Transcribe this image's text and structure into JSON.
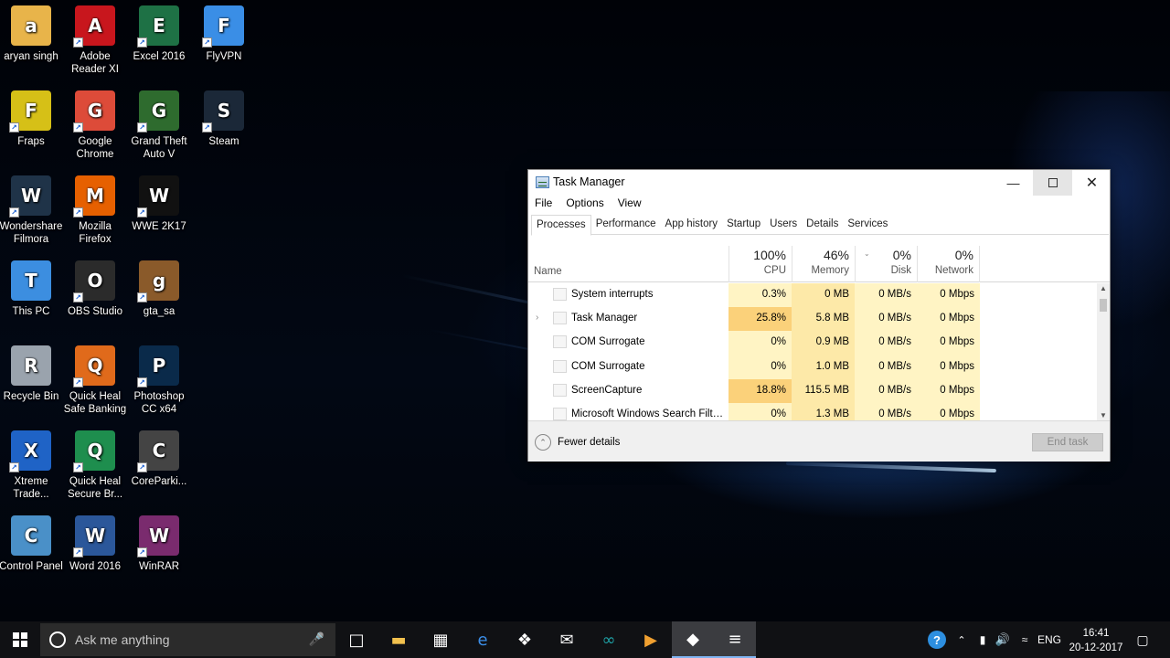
{
  "desktop": {
    "icons": [
      {
        "label": "aryan singh",
        "icon": "user-folder-icon",
        "color": "#e8b44a"
      },
      {
        "label": "Adobe Reader XI",
        "icon": "adobe-reader-icon",
        "color": "#c8161d"
      },
      {
        "label": "Excel 2016",
        "icon": "excel-icon",
        "color": "#1e7145"
      },
      {
        "label": "FlyVPN",
        "icon": "flyvpn-icon",
        "color": "#3a8ee6"
      },
      {
        "label": "Fraps",
        "icon": "fraps-icon",
        "color": "#d6c017"
      },
      {
        "label": "Google Chrome",
        "icon": "chrome-icon",
        "color": "#dd4b39"
      },
      {
        "label": "Grand Theft Auto V",
        "icon": "gta-v-icon",
        "color": "#2e6b2e"
      },
      {
        "label": "Steam",
        "icon": "steam-icon",
        "color": "#1b2838"
      },
      {
        "label": "Wondershare Filmora",
        "icon": "filmora-icon",
        "color": "#1f3348"
      },
      {
        "label": "Mozilla Firefox",
        "icon": "firefox-icon",
        "color": "#e66000"
      },
      {
        "label": "WWE 2K17",
        "icon": "wwe-icon",
        "color": "#111111"
      },
      {
        "label": "This PC",
        "icon": "this-pc-icon",
        "color": "#3c8ee0"
      },
      {
        "label": "OBS Studio",
        "icon": "obs-icon",
        "color": "#2b2b2b"
      },
      {
        "label": "gta_sa",
        "icon": "gta-sa-icon",
        "color": "#8a5a2a"
      },
      {
        "label": "Recycle Bin",
        "icon": "recycle-bin-icon",
        "color": "#9aa3ad"
      },
      {
        "label": "Quick Heal Safe Banking",
        "icon": "quick-heal-safe-banking-icon",
        "color": "#e06a1b"
      },
      {
        "label": "Photoshop CC x64",
        "icon": "photoshop-icon",
        "color": "#0a2a4a"
      },
      {
        "label": "Xtreme Trade...",
        "icon": "xtreme-trade-icon",
        "color": "#1f63c6"
      },
      {
        "label": "Quick Heal Secure Br...",
        "icon": "quick-heal-secure-browser-icon",
        "color": "#1e8e4e"
      },
      {
        "label": "CoreParki...",
        "icon": "coreparking-icon",
        "color": "#444444"
      },
      {
        "label": "Control Panel",
        "icon": "control-panel-icon",
        "color": "#4a90c8"
      },
      {
        "label": "Word 2016",
        "icon": "word-icon",
        "color": "#2b579a"
      },
      {
        "label": "WinRAR",
        "icon": "winrar-icon",
        "color": "#7a2b6e"
      }
    ]
  },
  "task_manager": {
    "title": "Task Manager",
    "menu": [
      "File",
      "Options",
      "View"
    ],
    "tabs": [
      "Processes",
      "Performance",
      "App history",
      "Startup",
      "Users",
      "Details",
      "Services"
    ],
    "active_tab": "Processes",
    "columns": {
      "name": "Name",
      "cpu": {
        "pct": "100%",
        "label": "CPU"
      },
      "memory": {
        "pct": "46%",
        "label": "Memory"
      },
      "disk": {
        "pct": "0%",
        "label": "Disk"
      },
      "network": {
        "pct": "0%",
        "label": "Network"
      }
    },
    "rows": [
      {
        "name": "System interrupts",
        "cpu": "0.3%",
        "memory": "0 MB",
        "disk": "0 MB/s",
        "network": "0 Mbps",
        "expandable": false
      },
      {
        "name": "Task Manager",
        "cpu": "25.8%",
        "memory": "5.8 MB",
        "disk": "0 MB/s",
        "network": "0 Mbps",
        "expandable": true
      },
      {
        "name": "COM Surrogate",
        "cpu": "0%",
        "memory": "0.9 MB",
        "disk": "0 MB/s",
        "network": "0 Mbps",
        "expandable": false
      },
      {
        "name": "COM Surrogate",
        "cpu": "0%",
        "memory": "1.0 MB",
        "disk": "0 MB/s",
        "network": "0 Mbps",
        "expandable": false
      },
      {
        "name": "ScreenCapture",
        "cpu": "18.8%",
        "memory": "115.5 MB",
        "disk": "0 MB/s",
        "network": "0 Mbps",
        "expandable": false
      },
      {
        "name": "Microsoft Windows Search Filte...",
        "cpu": "0%",
        "memory": "1.3 MB",
        "disk": "0 MB/s",
        "network": "0 Mbps",
        "expandable": false
      }
    ],
    "heat_colors": {
      "low": "#fff4c4",
      "mid": "#fde9a8",
      "high": "#fbd17a"
    },
    "fewer_details": "Fewer details",
    "end_task": "End task"
  },
  "taskbar": {
    "search_placeholder": "Ask me anything",
    "apps": [
      {
        "icon": "task-view-icon"
      },
      {
        "icon": "file-explorer-icon"
      },
      {
        "icon": "store-icon"
      },
      {
        "icon": "edge-icon"
      },
      {
        "icon": "dropbox-icon"
      },
      {
        "icon": "mail-icon"
      },
      {
        "icon": "arduino-icon"
      },
      {
        "icon": "media-player-icon"
      },
      {
        "icon": "filmora-taskbar-icon"
      },
      {
        "icon": "task-manager-taskbar-icon"
      }
    ],
    "tray": {
      "language": "ENG",
      "time": "16:41",
      "date": "20-12-2017"
    }
  }
}
